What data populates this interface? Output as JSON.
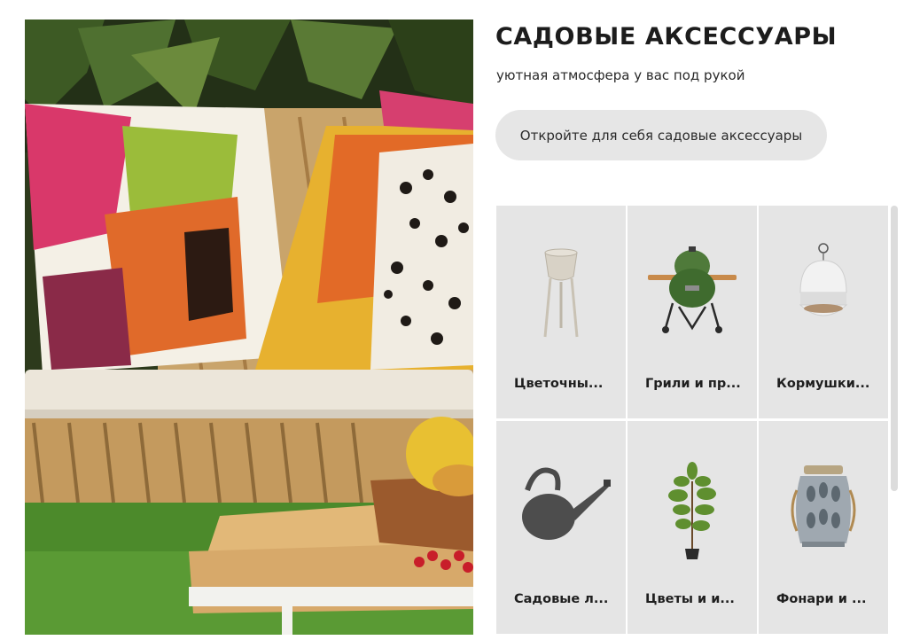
{
  "section": {
    "title": "САДОВЫЕ АКСЕССУАРЫ",
    "subtitle": "уютная атмосфера у вас под рукой",
    "cta_label": "Откройте для себя садовые аксессуары"
  },
  "categories": [
    {
      "label": "Цветочны...",
      "icon": "planter-stand-icon"
    },
    {
      "label": "Грили и пр...",
      "icon": "kamado-grill-icon"
    },
    {
      "label": "Кормушки...",
      "icon": "bird-feeder-icon"
    },
    {
      "label": "Садовые л...",
      "icon": "watering-can-icon"
    },
    {
      "label": "Цветы и и...",
      "icon": "potted-plant-icon"
    },
    {
      "label": "Фонари и ...",
      "icon": "lantern-icon"
    }
  ],
  "colors": {
    "tile_background": "#e5e5e5",
    "cta_background": "#e6e6e6",
    "title_text": "#1c1c1c"
  }
}
